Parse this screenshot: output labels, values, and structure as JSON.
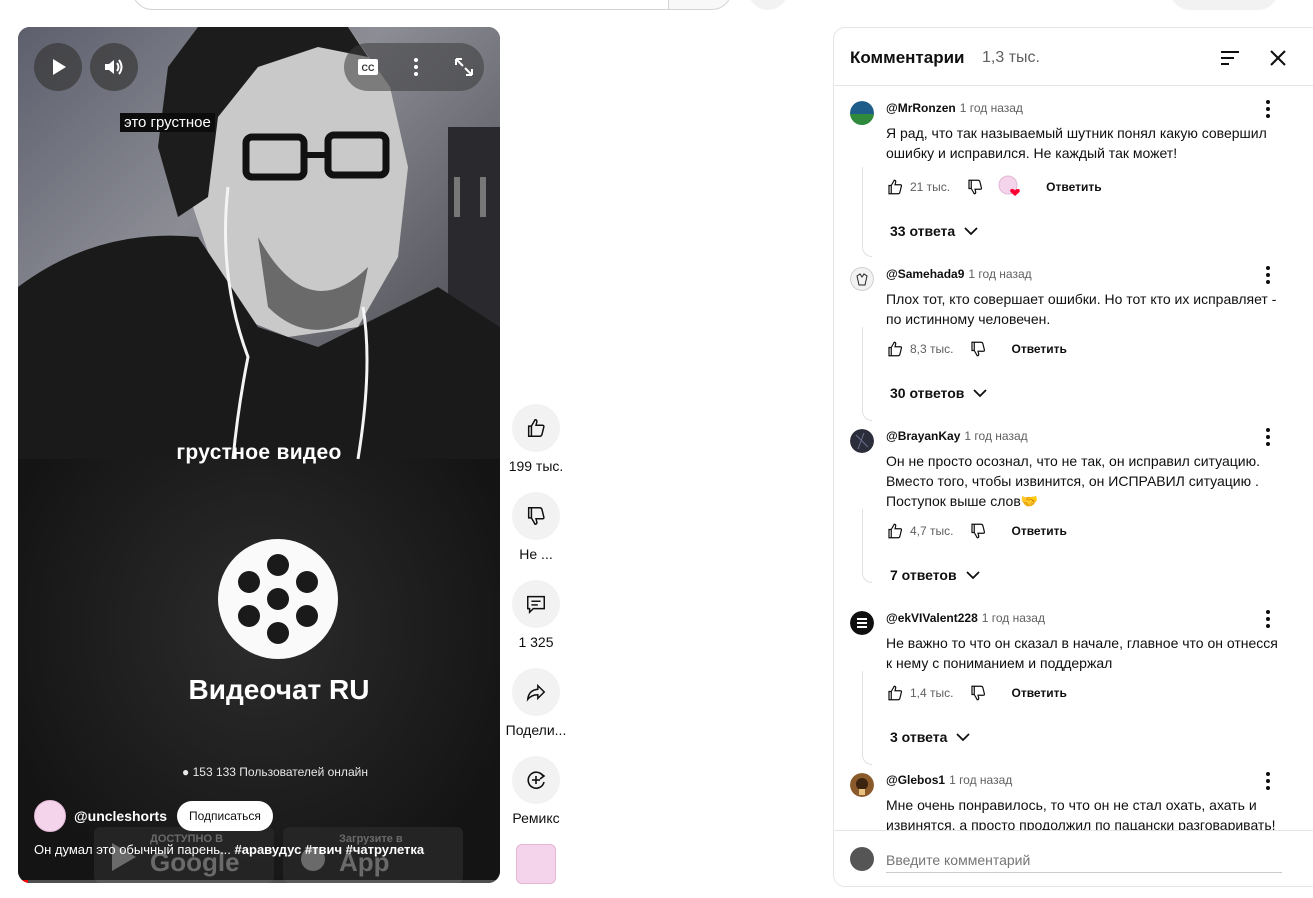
{
  "video": {
    "caption_text": "это грустное",
    "overlay_title": "грустное видео",
    "brand": "Видеочат RU",
    "online": "153 133 Пользователей онлайн",
    "badge_google_small": "ДОСТУПНО В",
    "badge_google_big": "Google Play",
    "badge_apple_small": "Загрузите в",
    "badge_apple_big": "App Store",
    "channel": "@uncleshorts",
    "subscribe": "Подписаться",
    "description_text": "Он думал это обычный парень...",
    "description_tags": "#аравудус #твич #чатрулетка",
    "cc_label": "CC",
    "progress_fraction": 0.02
  },
  "actions": {
    "like_count": "199 тыс.",
    "dislike_label": "Не ...",
    "comments_count": "1 325",
    "share_label": "Подели...",
    "remix_label": "Ремикс"
  },
  "comments_panel": {
    "title": "Комментарии",
    "count": "1,3 тыс.",
    "input_placeholder": "Введите комментарий",
    "comments": [
      {
        "author": "@MrRonzen",
        "time": "1 год назад",
        "text": "Я рад, что так называемый шутник понял какую совершил ошибку и исправился. Не каждый так может!",
        "likes": "21 тыс.",
        "reply": "Ответить",
        "replies": "33 ответа",
        "avatar_color": "#1e5c8a"
      },
      {
        "author": "@Samehada9",
        "time": "1 год назад",
        "text": "Плох тот, кто совершает ошибки. Но тот кто их исправляет - по истинному человечен.",
        "likes": "8,3 тыс.",
        "reply": "Ответить",
        "replies": "30 ответов",
        "avatar_color": "#f2f2f2"
      },
      {
        "author": "@BrayanKay",
        "time": "1 год назад",
        "text": "Он не просто осознал, что не так, он исправил ситуацию. Вместо того, чтобы извинится, он ИСПРАВИЛ ситуацию . Поступок выше слов🤝",
        "likes": "4,7 тыс.",
        "reply": "Ответить",
        "replies": "7 ответов",
        "avatar_color": "#2b2d3a"
      },
      {
        "author": "@ekVIValent228",
        "time": "1 год назад",
        "text": "Не важно то что он сказал в начале, главное что он отнесся к нему с пониманием и поддержал",
        "likes": "1,4 тыс.",
        "reply": "Ответить",
        "replies": "3 ответа",
        "avatar_color": "#0f0f0f"
      },
      {
        "author": "@Glebos1",
        "time": "1 год назад",
        "text": "Мне очень понравилось, то что он не стал охать, ахать и извинятся, а просто продолжил по пацански разговаривать!",
        "avatar_color": "#8a5a2a"
      }
    ]
  }
}
